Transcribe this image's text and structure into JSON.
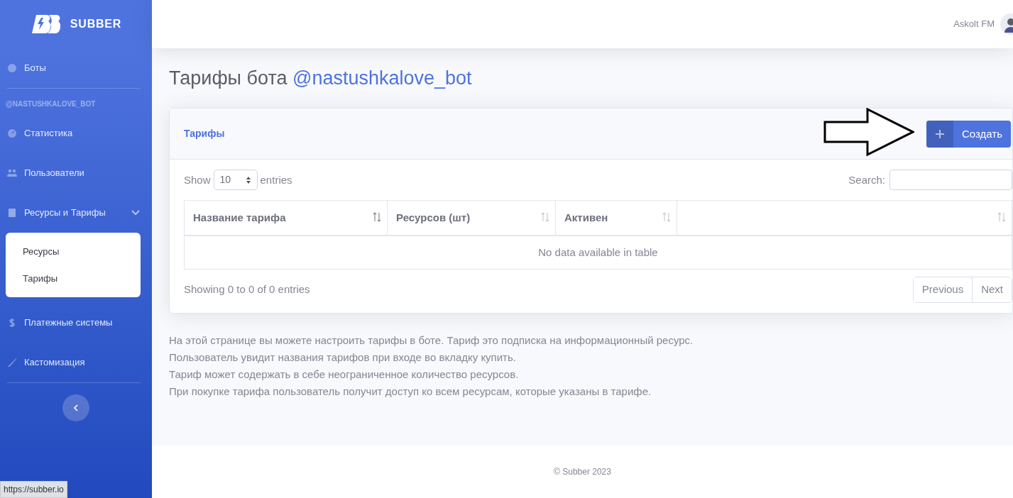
{
  "sidebar": {
    "brand": "SUBBER",
    "items": [
      {
        "kind": "link",
        "label": "Боты"
      },
      {
        "kind": "divider"
      },
      {
        "kind": "heading",
        "label": "@NASTUSHKALOVE_BOT"
      },
      {
        "kind": "link",
        "label": "Статистика"
      },
      {
        "kind": "link",
        "label": "Пользователи"
      },
      {
        "kind": "group",
        "label": "Ресурсы и Тарифы",
        "expanded": true,
        "children": [
          {
            "label": "Ресурсы"
          },
          {
            "label": "Тарифы"
          }
        ]
      },
      {
        "kind": "link",
        "label": "Платежные системы"
      },
      {
        "kind": "link",
        "label": "Кастомизация"
      },
      {
        "kind": "divider"
      }
    ]
  },
  "topbar": {
    "user": "Askolt FM"
  },
  "page_title": {
    "text": "Тарифы бота ",
    "bot": "@nastushkalove_bot"
  },
  "card": {
    "title": "Тарифы",
    "create_button": "Создать",
    "length": {
      "before": "Show",
      "value": "10",
      "after": "entries"
    },
    "search": {
      "label": "Search:"
    },
    "table": {
      "columns": [
        "Название тарифа",
        "Ресурсов (шт)",
        "Активен"
      ],
      "empty": "No data available in table"
    },
    "info": "Showing 0 to 0 of 0 entries",
    "pager": [
      "Previous",
      "Next"
    ]
  },
  "help": [
    "На этой странице вы можете настроить тарифы в боте. Тариф это подписка на информационный ресурс.",
    "Пользователь увидит названия тарифов при входе во вкладку купить.",
    "Тариф может содержать в себе неограниченное количество ресурсов.",
    "При покупке тарифа пользователь получит доступ ко всем ресурсам, которые указаны в тарифе."
  ],
  "footer": "© Subber 2023",
  "status_url": "https://subber.io"
}
